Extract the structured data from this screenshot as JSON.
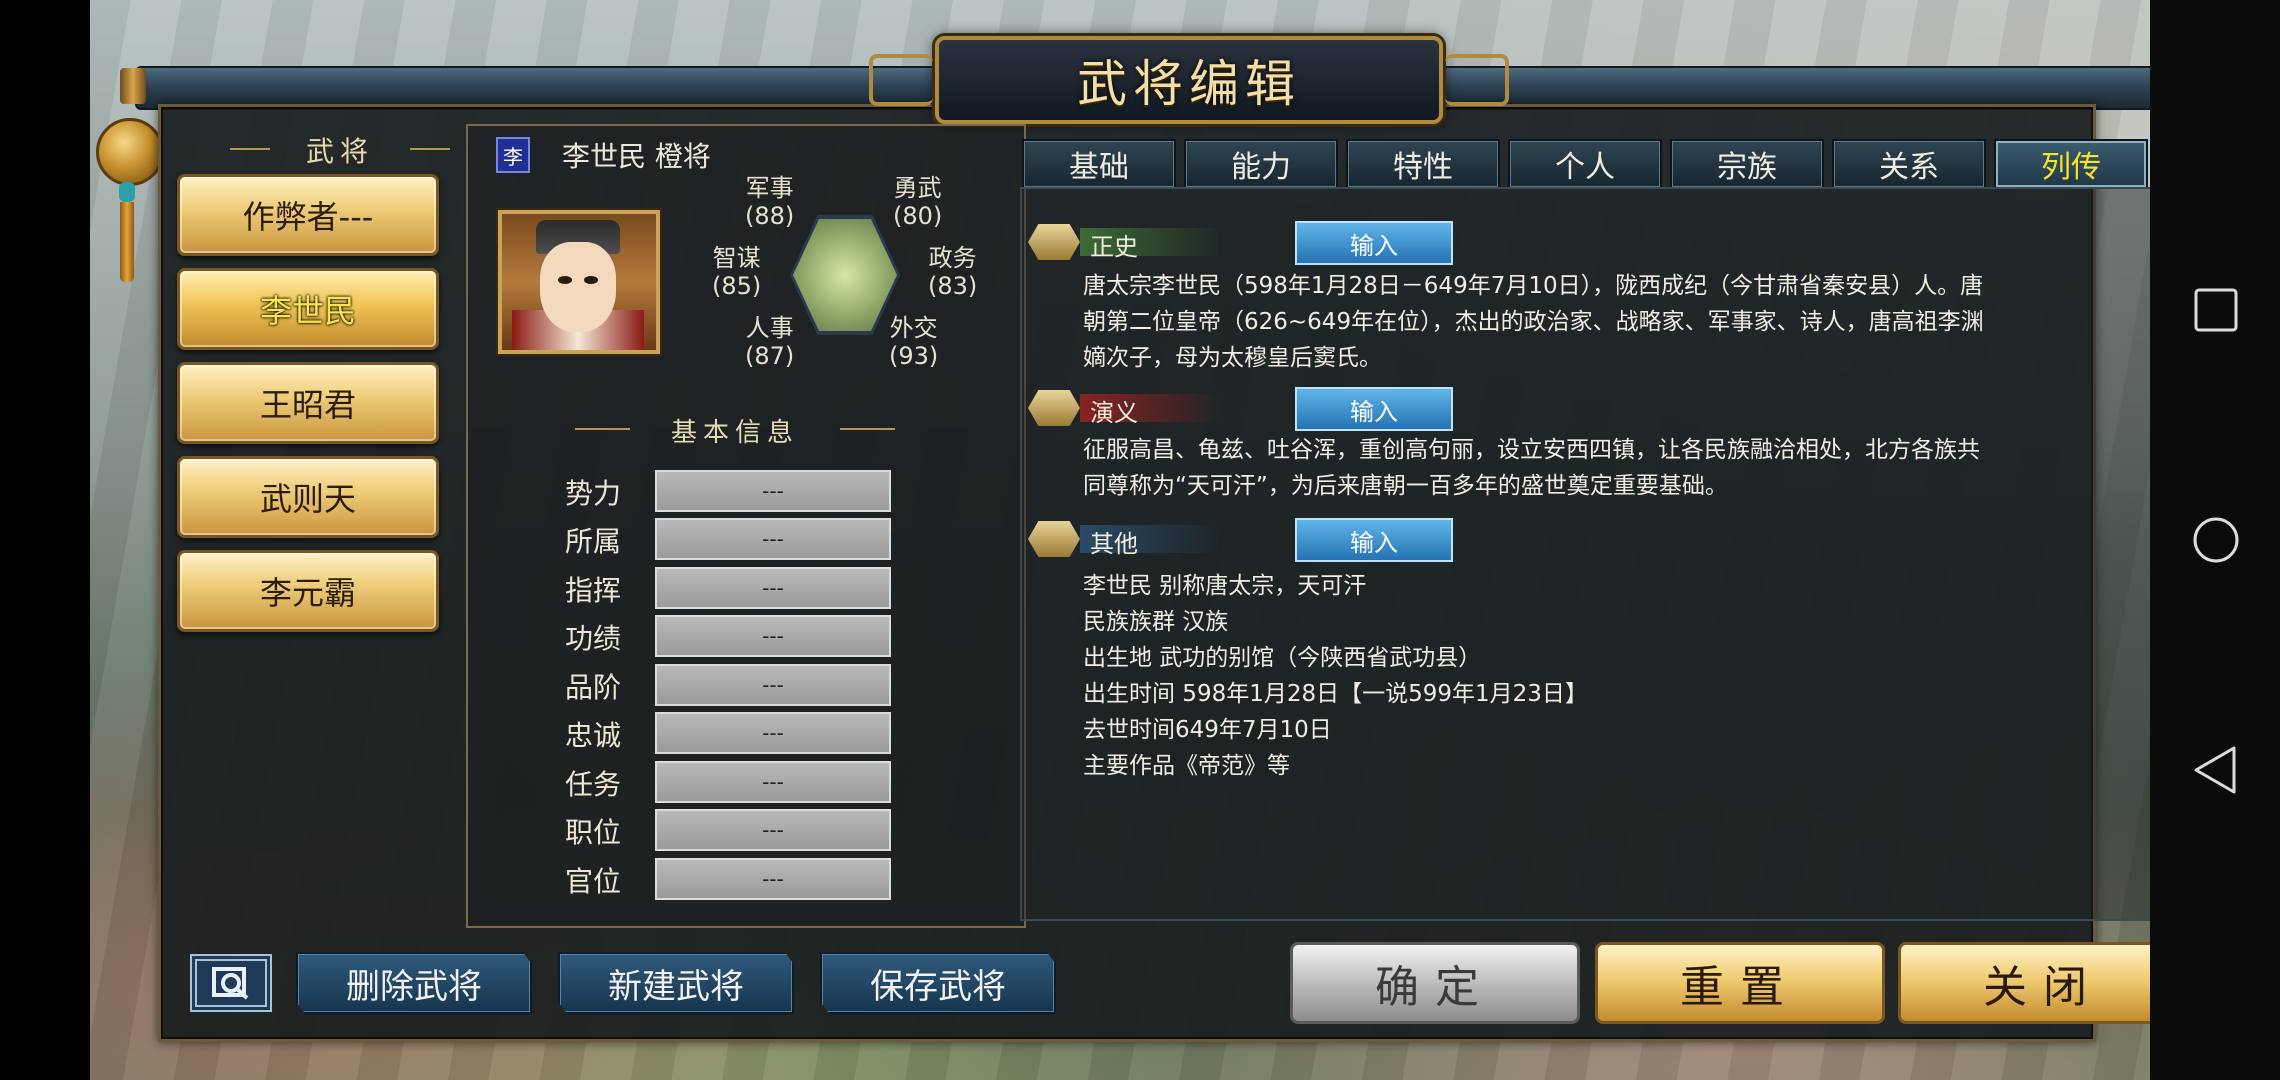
{
  "window_title": "武将编辑",
  "sidebar": {
    "heading": "武将",
    "generals": [
      {
        "label": "作弊者---"
      },
      {
        "label": "李世民"
      },
      {
        "label": "王昭君"
      },
      {
        "label": "武则天"
      },
      {
        "label": "李元霸"
      }
    ],
    "selected": "李世民"
  },
  "profile": {
    "seal_char": "李",
    "name_line": "李世民  橙将",
    "stats": {
      "military": {
        "label": "军事",
        "value": "(88)"
      },
      "bravery": {
        "label": "勇武",
        "value": "(80)"
      },
      "strategy": {
        "label": "智谋",
        "value": "(85)"
      },
      "politics": {
        "label": "政务",
        "value": "(83)"
      },
      "personnel": {
        "label": "人事",
        "value": "(87)"
      },
      "diplomacy": {
        "label": "外交",
        "value": "(93)"
      }
    }
  },
  "basic_info": {
    "title": "基本信息",
    "fields": [
      {
        "label": "势力",
        "value": "---"
      },
      {
        "label": "所属",
        "value": "---"
      },
      {
        "label": "指挥",
        "value": "---"
      },
      {
        "label": "功绩",
        "value": "---"
      },
      {
        "label": "品阶",
        "value": "---"
      },
      {
        "label": "忠诚",
        "value": "---"
      },
      {
        "label": "任务",
        "value": "---"
      },
      {
        "label": "职位",
        "value": "---"
      },
      {
        "label": "官位",
        "value": "---"
      }
    ]
  },
  "tabs": [
    {
      "label": "基础"
    },
    {
      "label": "能力"
    },
    {
      "label": "特性"
    },
    {
      "label": "个人"
    },
    {
      "label": "宗族"
    },
    {
      "label": "关系"
    },
    {
      "label": "列传"
    }
  ],
  "active_tab": "列传",
  "biography": {
    "input_label": "输入",
    "history": {
      "label": "正史",
      "lines": [
        "唐太宗李世民（598年1月28日－649年7月10日），陇西成纪（今甘肃省秦安县）人。唐",
        "朝第二位皇帝（626~649年在位），杰出的政治家、战略家、军事家、诗人，唐高祖李渊",
        "嫡次子，母为太穆皇后窦氏。"
      ]
    },
    "romance": {
      "label": "演义",
      "lines": [
        "征服高昌、龟兹、吐谷浑，重创高句丽，设立安西四镇，让各民族融洽相处，北方各族共",
        "同尊称为“天可汗”，为后来唐朝一百多年的盛世奠定重要基础。"
      ]
    },
    "other": {
      "label": "其他",
      "lines": [
        "李世民 别称唐太宗，天可汗",
        "民族族群 汉族",
        "出生地 武功的别馆（今陕西省武功县）",
        "出生时间 598年1月28日【一说599年1月23日】",
        "去世时间649年7月10日",
        "主要作品《帝范》等"
      ]
    }
  },
  "bottom_bar": {
    "delete_label": "删除武将",
    "new_label": "新建武将",
    "save_label": "保存武将",
    "confirm_label": "确定",
    "reset_label": "重置",
    "close_label": "关闭"
  },
  "colors": {
    "active_text": "#f6e42a",
    "gold_button": "#f0cc72",
    "tab_bg": "#2f4554",
    "input_button": "#2673b4",
    "section_history": "#3d6b35",
    "section_romance": "#8a2323",
    "section_other": "#2a4a66"
  }
}
